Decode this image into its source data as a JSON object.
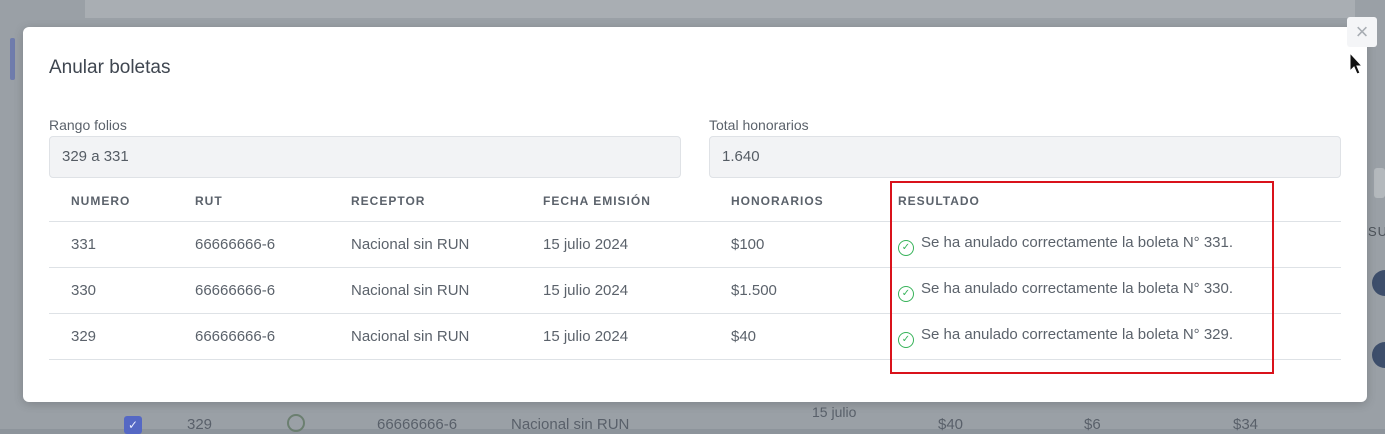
{
  "modal": {
    "title": "Anular boletas",
    "close_symbol": "×",
    "range_label": "Rango folios",
    "range_value": "329 a 331",
    "total_label": "Total honorarios",
    "total_value": "1.640"
  },
  "table": {
    "headers": [
      "NUMERO",
      "RUT",
      "RECEPTOR",
      "FECHA EMISIÓN",
      "HONORARIOS",
      "RESULTADO"
    ],
    "rows": [
      {
        "numero": "331",
        "rut": "66666666-6",
        "receptor": "Nacional sin RUN",
        "fecha": "15 julio 2024",
        "honorarios": "$100",
        "resultado": "Se ha anulado correctamente la boleta N° 331."
      },
      {
        "numero": "330",
        "rut": "66666666-6",
        "receptor": "Nacional sin RUN",
        "fecha": "15 julio 2024",
        "honorarios": "$1.500",
        "resultado": "Se ha anulado correctamente la boleta N° 330."
      },
      {
        "numero": "329",
        "rut": "66666666-6",
        "receptor": "Nacional sin RUN",
        "fecha": "15 julio 2024",
        "honorarios": "$40",
        "resultado": "Se ha anulado correctamente la boleta N° 329."
      }
    ]
  },
  "background": {
    "row": {
      "numero": "329",
      "rut": "66666666-6",
      "receptor": "Nacional sin RUN",
      "fecha": "15 julio",
      "honorarios": "$40",
      "col6": "$6",
      "col7": "$34"
    },
    "right_text": "SU"
  },
  "icons": {
    "success": "check-circle-icon",
    "close": "close-icon"
  },
  "colors": {
    "success": "#38b35a",
    "highlight": "#d9121b",
    "accent": "#4c5fb0"
  }
}
